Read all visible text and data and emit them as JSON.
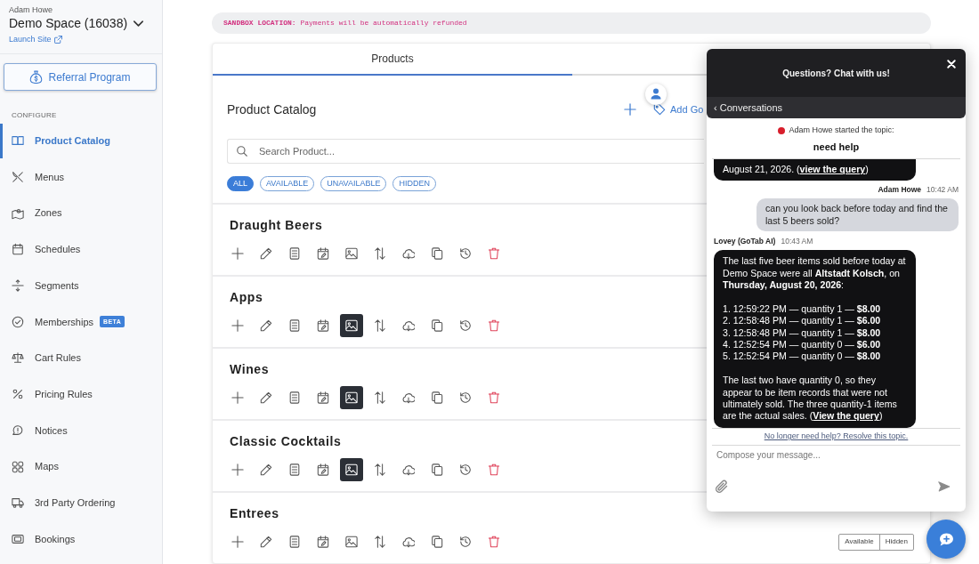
{
  "sidebar": {
    "user": "Adam Howe",
    "space": "Demo Space (16038)",
    "launch_link": "Launch Site",
    "referral_button": "Referral Program",
    "section_label": "CONFIGURE",
    "items": [
      {
        "label": "Product Catalog",
        "selected": true
      },
      {
        "label": "Menus",
        "selected": false
      },
      {
        "label": "Zones",
        "selected": false
      },
      {
        "label": "Schedules",
        "selected": false
      },
      {
        "label": "Segments",
        "selected": false
      },
      {
        "label": "Memberships",
        "selected": false,
        "badge": "BETA"
      },
      {
        "label": "Cart Rules",
        "selected": false
      },
      {
        "label": "Pricing Rules",
        "selected": false
      },
      {
        "label": "Notices",
        "selected": false
      },
      {
        "label": "Maps",
        "selected": false
      },
      {
        "label": "3rd Party Ordering",
        "selected": false
      },
      {
        "label": "Bookings",
        "selected": false
      }
    ]
  },
  "banner": {
    "text": "**SANDBOX LOCATION:** Payments will be automatically refunded"
  },
  "tabs": [
    {
      "label": "Products",
      "selected": true
    }
  ],
  "catalog": {
    "title": "Product Catalog",
    "add_label": "Add Go",
    "search": {
      "placeholder": "Search Product..."
    },
    "filters": [
      {
        "label": "ALL",
        "selected": true
      },
      {
        "label": "AVAILABLE",
        "selected": false
      },
      {
        "label": "UNAVAILABLE",
        "selected": false
      },
      {
        "label": "HIDDEN",
        "selected": false
      }
    ],
    "categories": [
      {
        "title": "Draught Beers",
        "show_images": false
      },
      {
        "title": "Apps",
        "show_images": true
      },
      {
        "title": "Wines",
        "show_images": true
      },
      {
        "title": "Classic Cocktails",
        "show_images": true
      },
      {
        "title": "Entrees",
        "show_images": false,
        "visibility_options": [
          "Available",
          "Hidden"
        ]
      }
    ]
  },
  "chat": {
    "title": "Questions? Chat with us!",
    "back_label": "‹ Conversations",
    "topic": {
      "intro": "Adam Howe started the topic:",
      "title": "need help"
    },
    "messages": [
      {
        "kind": "bot",
        "blocks": [
          {
            "kind": "text",
            "text": "August 21, 2026. (",
            "link": "view the query",
            "after": ")"
          }
        ]
      },
      {
        "kind": "user",
        "author": "Adam Howe",
        "time": "10:42 AM",
        "blocks": [
          {
            "kind": "text",
            "text": "can you look back before today and find the last 5 beers sold?"
          }
        ]
      },
      {
        "kind": "bot",
        "author": "Lovey (GoTab AI)",
        "time": "10:43 AM",
        "blocks": [
          {
            "kind": "text",
            "text": "The last five beer items sold before today at Demo Space were all **Altstadt Kolsch**, on **Thursday, August 20, 2026**:"
          },
          {
            "kind": "list",
            "items": [
              "1. 12:59:22 PM — quantity 1 — **$8.00**",
              "2. 12:58:48 PM — quantity 1 — **$6.00**",
              "3. 12:58:48 PM — quantity 1 — **$8.00**",
              "4. 12:52:54 PM — quantity 0 — **$6.00**",
              "5. 12:52:54 PM — quantity 0 — **$8.00**"
            ]
          },
          {
            "kind": "text",
            "text": "The last two have quantity 0, so they appear to be item records that were not ultimately sold. The three quantity-1 items are the actual sales. (",
            "link": "View the query",
            "after": ")"
          }
        ]
      }
    ],
    "resolve_link": "No longer need help? Resolve this topic.",
    "composer": {
      "placeholder": "Compose your message..."
    }
  }
}
